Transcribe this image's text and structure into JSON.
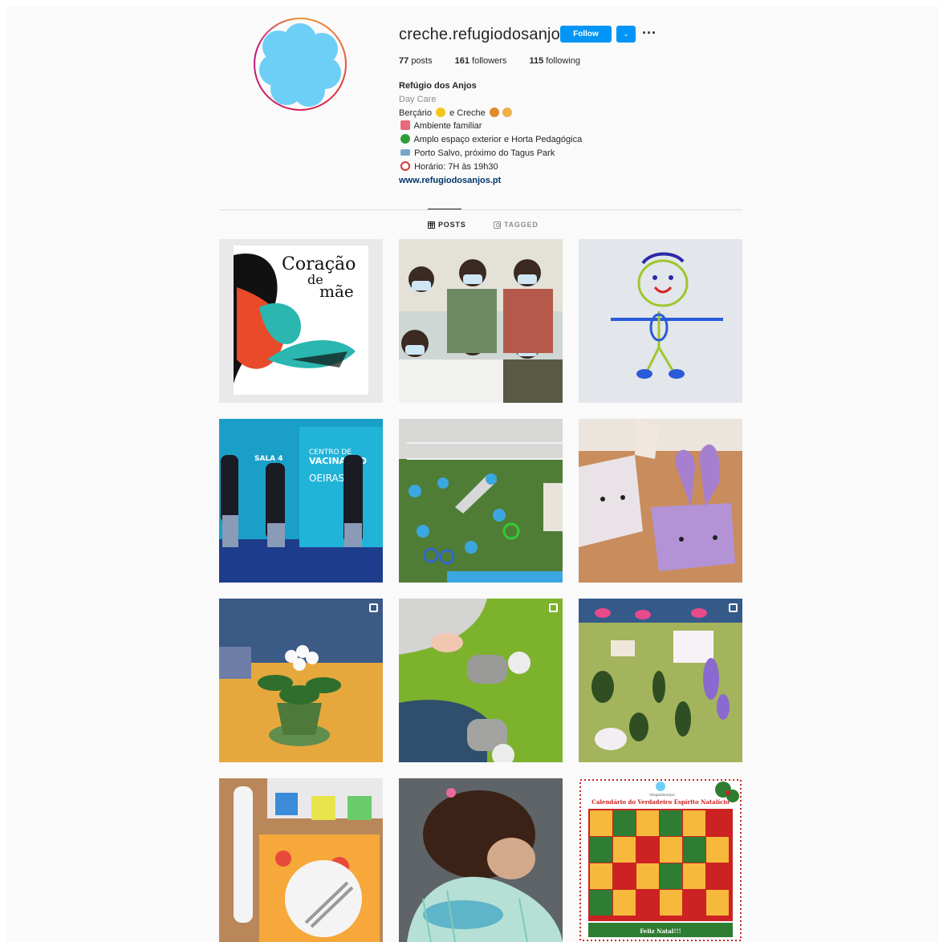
{
  "profile": {
    "username": "creche.refugiodosanjos",
    "follow_label": "Follow",
    "stats": {
      "posts_count": "77",
      "posts_label": "posts",
      "followers_count": "161",
      "followers_label": "followers",
      "following_count": "115",
      "following_label": "following"
    },
    "bio": {
      "name": "Refúgio dos Anjos",
      "category": "Day Care",
      "line1_a": "Berçário",
      "line1_b": "e Creche",
      "line2": "Ambiente familiar",
      "line3": "Amplo espaço exterior e Horta Pedagógica",
      "line4": "Porto Salvo, próximo do Tagus Park",
      "line5": "Horário: 7H às 19h30",
      "website": "www.refugiodosanjos.pt"
    }
  },
  "tabs": {
    "posts": "POSTS",
    "tagged": "TAGGED"
  },
  "colors": {
    "accent": "#0095f6",
    "avatar_fill": "#6ecff6"
  },
  "posts": [
    {
      "theme": "book cover",
      "multi": false
    },
    {
      "theme": "group photo",
      "multi": false
    },
    {
      "theme": "child drawing",
      "multi": false
    },
    {
      "theme": "vaccination center",
      "multi": false
    },
    {
      "theme": "playground",
      "multi": false
    },
    {
      "theme": "paper bunnies",
      "multi": false
    },
    {
      "theme": "flower pot",
      "multi": true
    },
    {
      "theme": "baby socks",
      "multi": true
    },
    {
      "theme": "leaves and flowers",
      "multi": true
    },
    {
      "theme": "table setting",
      "multi": false
    },
    {
      "theme": "child",
      "multi": false
    },
    {
      "theme": "christmas calendar",
      "multi": false
    }
  ],
  "calendar_post": {
    "brand": "refugiodosanjos",
    "title": "Calendário do Verdadeiro Espírito Natalício",
    "footer": "Feliz Natal!!!"
  },
  "book_post": {
    "title_line1": "Coração",
    "title_line2": "de",
    "title_line3": "mãe"
  },
  "vaccination_post": {
    "sign_line1": "CENTRO DE",
    "sign_line2": "VACINAÇÃO",
    "sign_line3": "OEIRAS",
    "side_sign": "SALA 4"
  }
}
